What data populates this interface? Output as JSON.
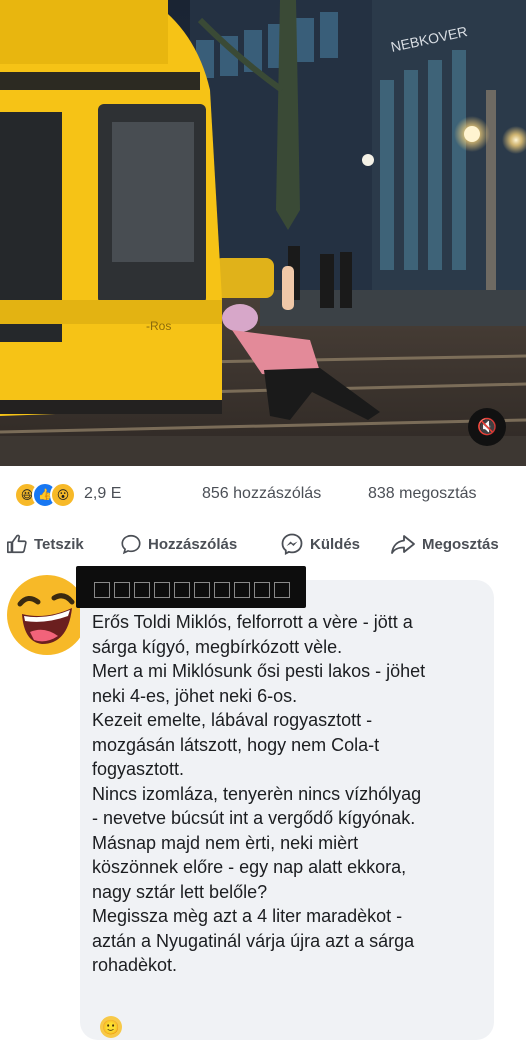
{
  "video": {
    "mute_icon": "speaker-muted-icon",
    "tram_marking": "-Ros",
    "building_sign": "NEBKOVER"
  },
  "stats": {
    "reaction_icons": [
      "haha-icon",
      "like-icon",
      "wow-icon"
    ],
    "reaction_count": "2,9 E",
    "comments": "856 hozzászólás",
    "shares": "838 megosztás"
  },
  "actions": {
    "like": "Tetszik",
    "comment": "Hozzászólás",
    "send": "Küldés",
    "share": "Megosztás"
  },
  "comment": {
    "avatar": "laughing-emoji-avatar",
    "author_redacted": true,
    "text": "Erős Toldi Miklós, felforrott a vère - jött a\nsárga kígyó, megbírkózott vèle.\nMert a mi Miklósunk ősi pesti lakos - jöhet\nneki 4-es, jöhet neki 6-os.\nKezeit emelte, lábával rogyasztott -\nmozgásán látszott, hogy nem Cola-t\nfogyasztott.\nNincs izomláza, tenyerèn nincs vízhólyag\n- nevetve búcsút int a vergődő kígyónak.\nMásnap majd nem èrti, neki mièrt\nköszönnek előre - egy nap alatt ekkora,\nnagy sztár lett belőle?\nMegissza mèg azt a 4 liter maradèkot  -\naztán a  Nyugatinál várja újra azt a sárga\nrohadèkot.",
    "trailing_emoji": "🙂"
  },
  "colors": {
    "tram_yellow": "#f6c316",
    "fb_blue": "#1877f2",
    "bubble_bg": "#f0f2f5",
    "meta_text": "#4b4f56"
  }
}
